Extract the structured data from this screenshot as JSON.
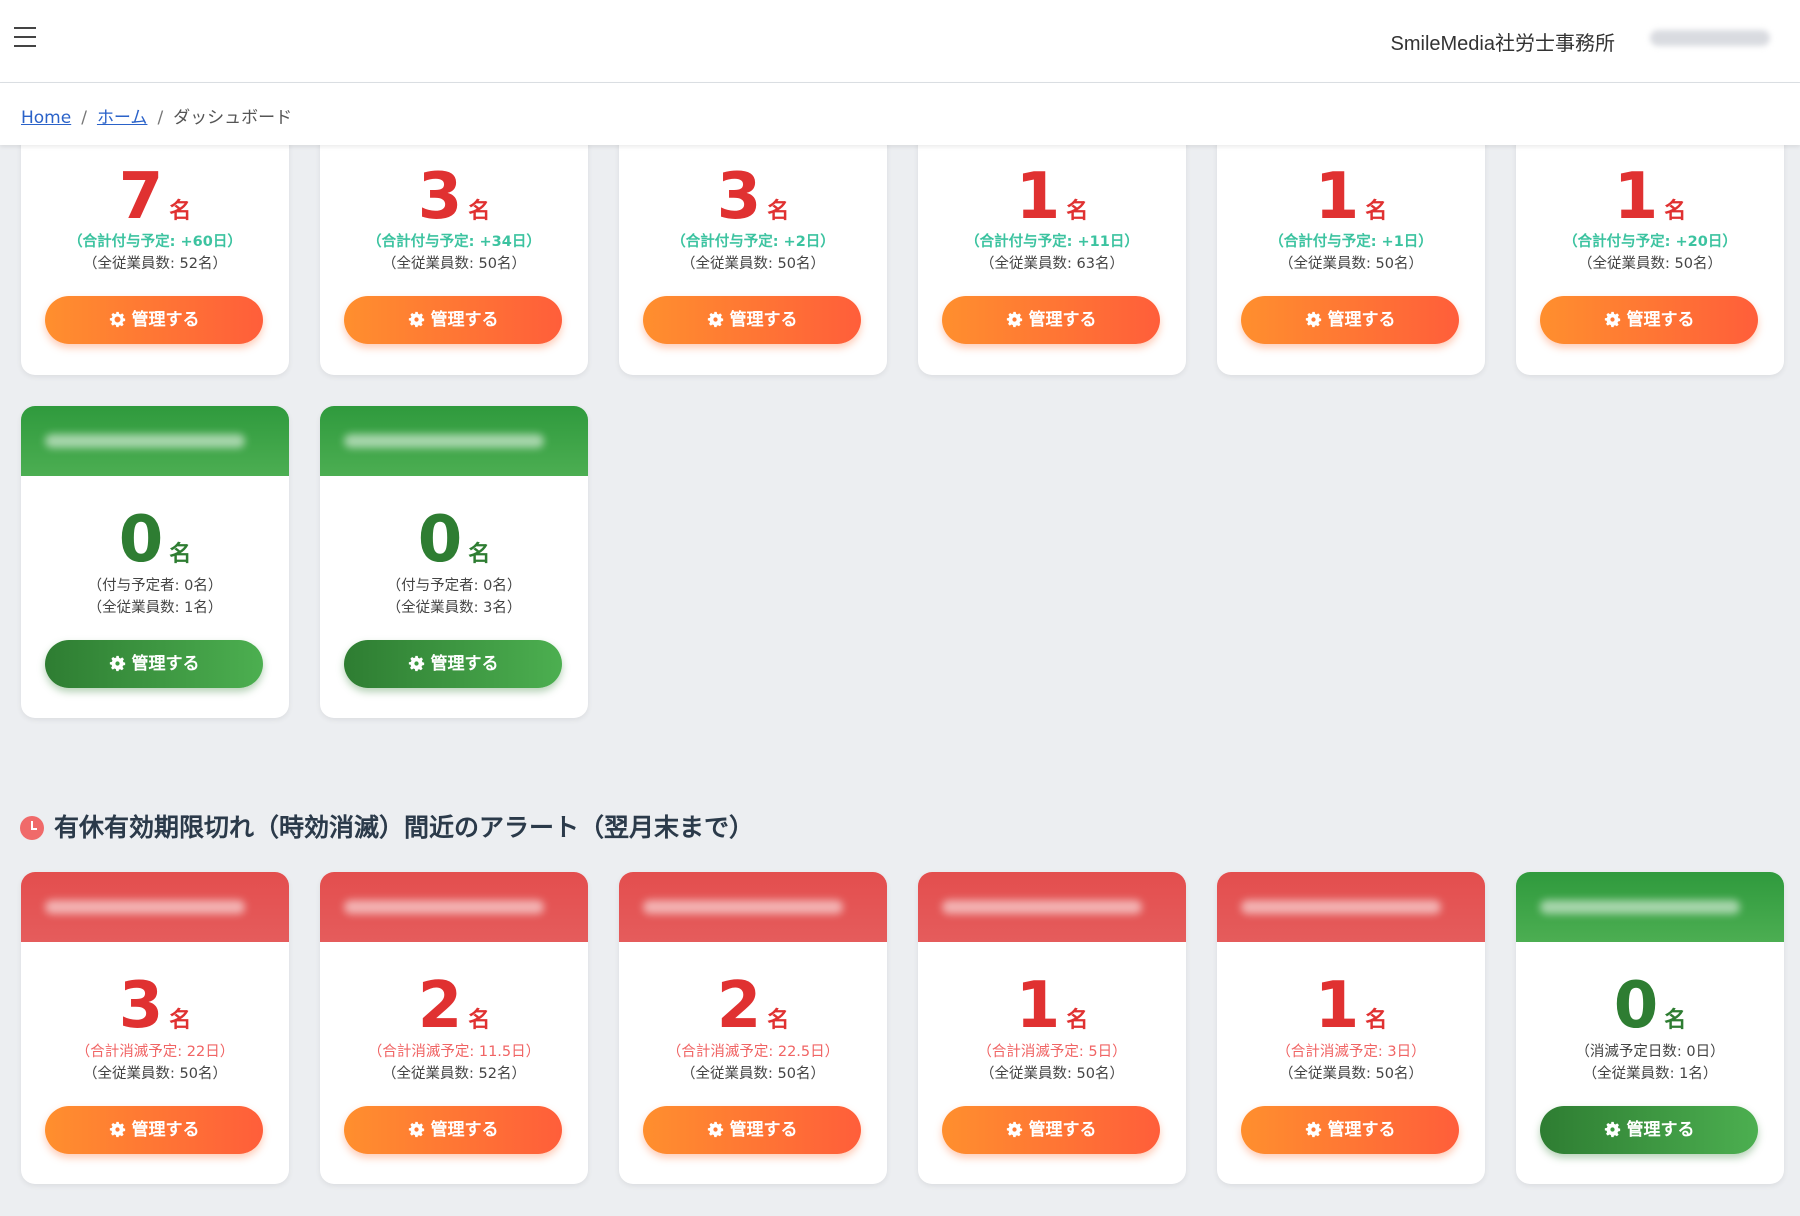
{
  "header": {
    "office_name": "SmileMedia社労士事務所"
  },
  "breadcrumb": {
    "home": "Home",
    "home_jp": "ホーム",
    "current": "ダッシュボード",
    "separator": "/"
  },
  "colors": {
    "red_accent": "#e03131",
    "green_accent": "#2e7d32",
    "orange_button": "#ff7a35",
    "teal_text": "#3cc3a0"
  },
  "manage_label": "管理する",
  "unit": "名",
  "grant_row1": [
    {
      "count": "7",
      "sub1": "（合計付与予定: +60日）",
      "sub2": "（全従業員数: 52名）"
    },
    {
      "count": "3",
      "sub1": "（合計付与予定: +34日）",
      "sub2": "（全従業員数: 50名）"
    },
    {
      "count": "3",
      "sub1": "（合計付与予定: +2日）",
      "sub2": "（全従業員数: 50名）"
    },
    {
      "count": "1",
      "sub1": "（合計付与予定: +11日）",
      "sub2": "（全従業員数: 63名）"
    },
    {
      "count": "1",
      "sub1": "（合計付与予定: +1日）",
      "sub2": "（全従業員数: 50名）"
    },
    {
      "count": "1",
      "sub1": "（合計付与予定: +20日）",
      "sub2": "（全従業員数: 50名）"
    }
  ],
  "grant_row2": [
    {
      "count": "0",
      "sub1": "（付与予定者: 0名）",
      "sub2": "（全従業員数: 1名）"
    },
    {
      "count": "0",
      "sub1": "（付与予定者: 0名）",
      "sub2": "（全従業員数: 3名）"
    }
  ],
  "expiry_section": {
    "title": "有休有効期限切れ（時効消滅）間近のアラート（翌月末まで）",
    "cards": [
      {
        "count": "3",
        "sub1": "（合計消滅予定: 22日）",
        "sub2": "（全従業員数: 50名）"
      },
      {
        "count": "2",
        "sub1": "（合計消滅予定: 11.5日）",
        "sub2": "（全従業員数: 52名）"
      },
      {
        "count": "2",
        "sub1": "（合計消滅予定: 22.5日）",
        "sub2": "（全従業員数: 50名）"
      },
      {
        "count": "1",
        "sub1": "（合計消滅予定: 5日）",
        "sub2": "（全従業員数: 50名）"
      },
      {
        "count": "1",
        "sub1": "（合計消滅予定: 3日）",
        "sub2": "（全従業員数: 50名）"
      },
      {
        "count": "0",
        "sub1": "（消滅予定日数: 0日）",
        "sub2": "（全従業員数: 1名）"
      }
    ]
  }
}
